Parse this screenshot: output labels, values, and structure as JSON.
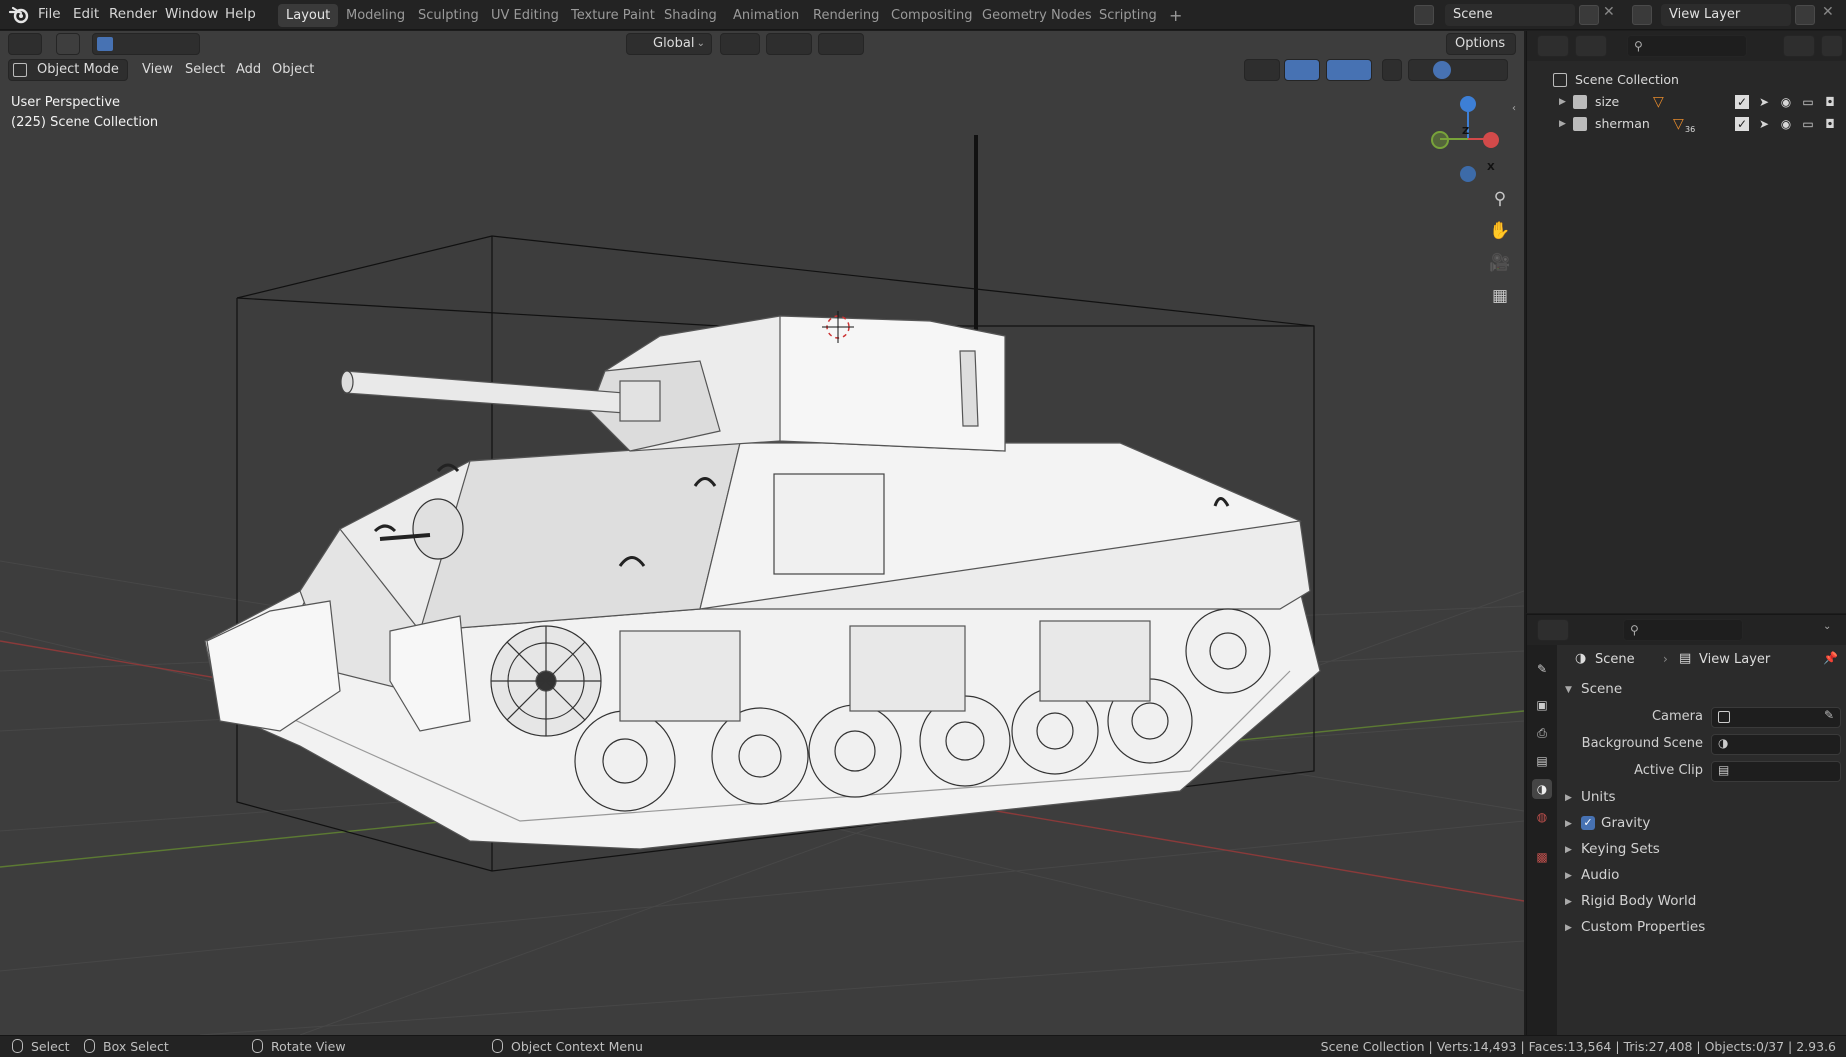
{
  "menu": {
    "file": "File",
    "edit": "Edit",
    "render": "Render",
    "window": "Window",
    "help": "Help"
  },
  "workspaces": [
    "Layout",
    "Modeling",
    "Sculpting",
    "UV Editing",
    "Texture Paint",
    "Shading",
    "Animation",
    "Rendering",
    "Compositing",
    "Geometry Nodes",
    "Scripting"
  ],
  "active_workspace": "Layout",
  "scene_field": "Scene",
  "view_layer_field": "View Layer",
  "toolbar": {
    "orientation": "Global",
    "options": "Options"
  },
  "viewport_header": {
    "mode": "Object Mode",
    "view": "View",
    "select": "Select",
    "add": "Add",
    "object": "Object"
  },
  "viewport_info": {
    "perspective": "User Perspective",
    "collection": "(225) Scene Collection"
  },
  "gizmo": {
    "z": "Z",
    "x": "X"
  },
  "outliner": {
    "root": "Scene Collection",
    "items": [
      {
        "label": "size",
        "modifier_count": ""
      },
      {
        "label": "sherman",
        "modifier_count": "36"
      }
    ]
  },
  "properties": {
    "breadcrumb_scene": "Scene",
    "breadcrumb_view_layer": "View Layer",
    "panel_title": "Scene",
    "camera_label": "Camera",
    "background_scene_label": "Background Scene",
    "active_clip_label": "Active Clip",
    "sections": [
      "Units",
      "Gravity",
      "Keying Sets",
      "Audio",
      "Rigid Body World",
      "Custom Properties"
    ],
    "gravity_enabled": true
  },
  "statusbar": {
    "select": "Select",
    "box_select": "Box Select",
    "rotate_view": "Rotate View",
    "context_menu": "Object Context Menu",
    "stats": "Scene Collection | Verts:14,493 | Faces:13,564 | Tris:27,408 | Objects:0/37 | 2.93.6"
  },
  "colors": {
    "accent_blue": "#4772b3",
    "x_axis": "#d24a4a",
    "y_axis": "#78a33a",
    "z_axis": "#3d7fd6",
    "viewport_bg": "#3d3d3d"
  }
}
